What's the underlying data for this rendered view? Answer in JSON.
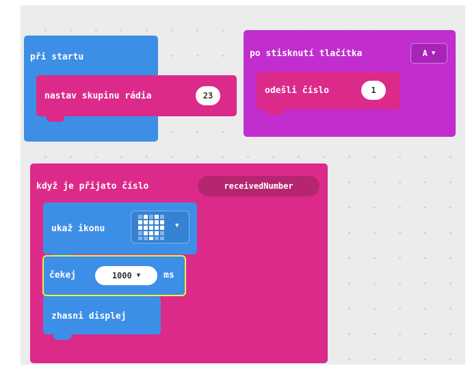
{
  "colors": {
    "workspace": "#ececec",
    "basic": "#3d8ee6",
    "radio": "#dc2a8a",
    "radio_dark": "#b52670",
    "input": "#c12dcf",
    "highlight": "#f2ef3b"
  },
  "on_start": {
    "label": "při startu",
    "set_group": {
      "label": "nastav skupinu rádia",
      "value": "23"
    }
  },
  "on_button": {
    "label": "po stisknutí tlačítka",
    "button_value": "A",
    "send": {
      "label": "odešli číslo",
      "value": "1"
    }
  },
  "on_received": {
    "label": "když je přijato číslo",
    "variable": "receivedNumber",
    "show_icon": {
      "label": "ukaž ikonu",
      "icon": "heart-icon"
    },
    "pause": {
      "label": "čekej",
      "value": "1000",
      "unit": "ms"
    },
    "clear": {
      "label": "zhasni displej"
    }
  }
}
